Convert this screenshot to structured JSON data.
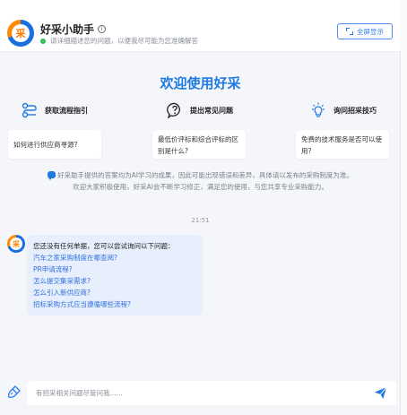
{
  "header": {
    "title": "好采小助手",
    "subtitle": "请详细描述您的问题，以便我尽可能为您准确解答",
    "fullscreen_label": "全屏显示",
    "logo_text": "采"
  },
  "welcome": "欢迎使用好采",
  "categories": [
    {
      "label": "获取流程指引",
      "icon": "flow-icon",
      "card": "如何进行供应商寻源?"
    },
    {
      "label": "提出常见问题",
      "icon": "question-bubble-icon",
      "card": "最低价评标和综合评标的区别是什么?"
    },
    {
      "label": "询问招采技巧",
      "icon": "lightbulb-icon",
      "card": "免费的技术服务是否可以使用?"
    }
  ],
  "notice": {
    "line1": "好采助手提供的答案均为AI学习的成果，因此可能出现错误和差异，具体请以发布的采购制度为准。",
    "line2": "欢迎大家积极使用，好采AI会不断学习修正，满足您的使用，与您共享专业采购能力。"
  },
  "chat": {
    "timestamp": "21:51",
    "intro": "您还没有任何单据，您可以尝试询问以下问题：",
    "suggestions": [
      "汽车之家采购制度在哪查阅?",
      "PR申请流程?",
      "怎么提交集采需求?",
      "怎么引入新供应商?",
      "招标采购方式应当遵循哪些流程?"
    ]
  },
  "input": {
    "placeholder": "有招采相关问题尽管问我......"
  },
  "colors": {
    "accent": "#1f7ae0",
    "link": "#2f6fde",
    "bubble": "#e7effd",
    "online": "#2fc25b",
    "brand_orange": "#ff7a00"
  }
}
